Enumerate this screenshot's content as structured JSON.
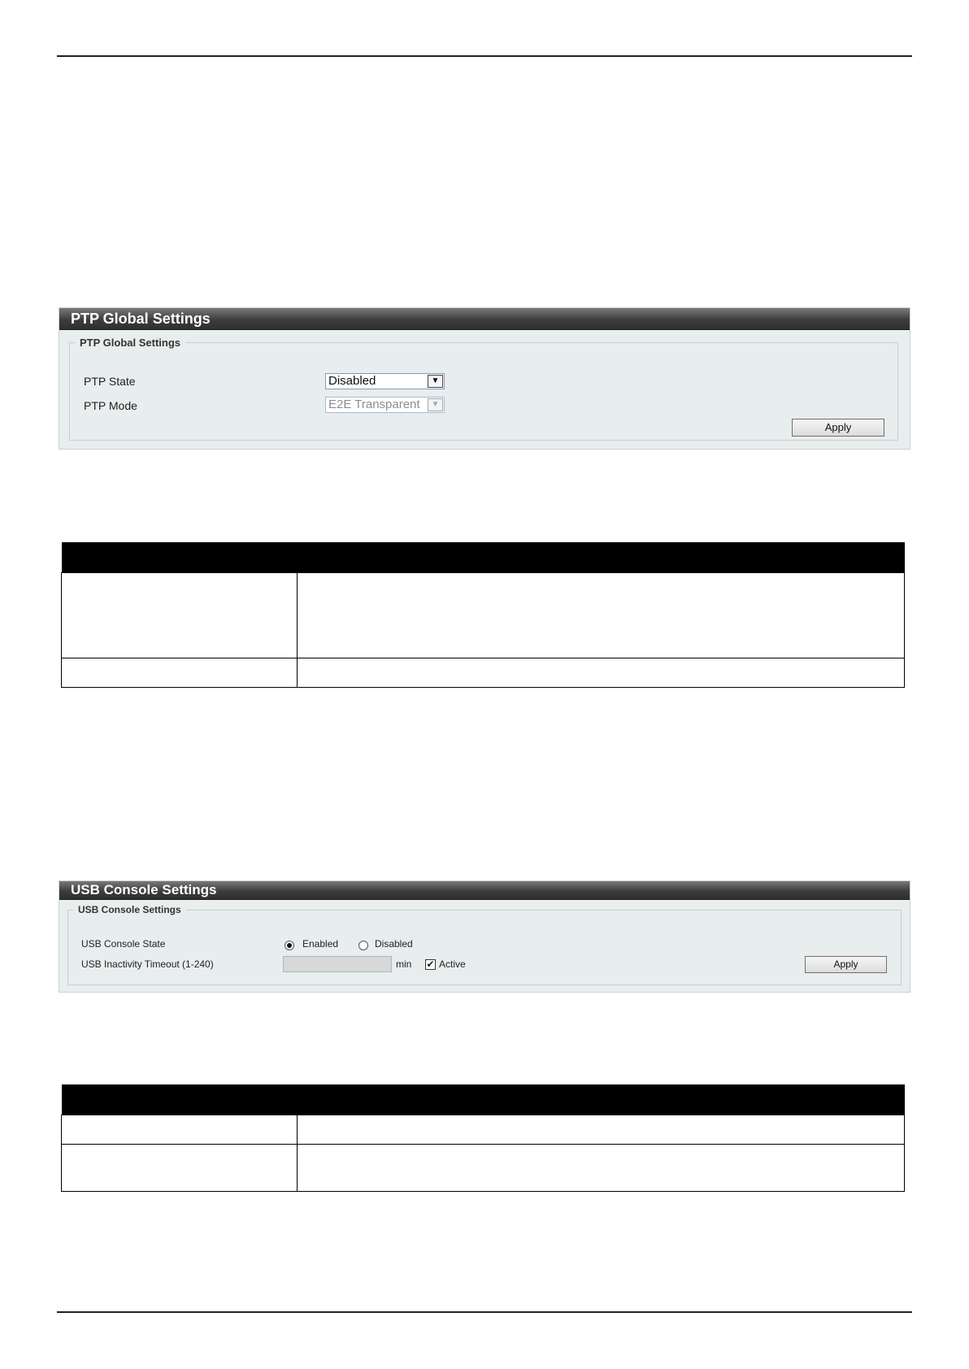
{
  "ptp": {
    "title": "PTP Global Settings",
    "legend": "PTP Global Settings",
    "state_label": "PTP State",
    "state_value": "Disabled",
    "mode_label": "PTP Mode",
    "mode_value": "E2E Transparent",
    "apply": "Apply"
  },
  "usb": {
    "title": "USB Console Settings",
    "legend": "USB Console Settings",
    "state_label": "USB Console State",
    "enabled": "Enabled",
    "disabled": "Disabled",
    "timeout_label": "USB Inactivity Timeout (1-240)",
    "timeout_value": "",
    "unit": "min",
    "active": "Active",
    "apply": "Apply"
  },
  "icons": {
    "dropdown": "chevron-down-icon",
    "check": "check-icon"
  }
}
